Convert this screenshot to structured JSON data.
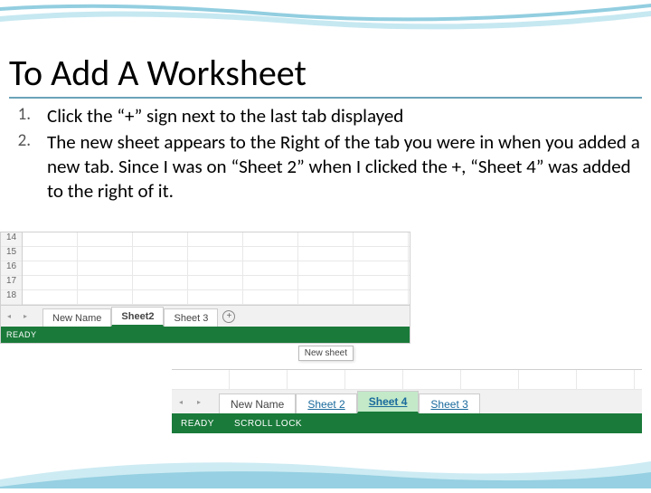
{
  "slide": {
    "title": "To Add A Worksheet",
    "steps": [
      {
        "num": "1.",
        "text": "Click the “+” sign next to the last tab displayed"
      },
      {
        "num": "2.",
        "text": "The new sheet appears to the Right of the tab you were in when you added a new tab. Since I was on “Sheet 2” when I clicked the +, “Sheet 4” was added to the right of it."
      }
    ]
  },
  "shot1": {
    "rows": [
      "14",
      "15",
      "16",
      "17",
      "18"
    ],
    "tabs": {
      "t1": "New Name",
      "t2": "Sheet2",
      "t3": "Sheet 3"
    },
    "add_symbol": "+",
    "status": "READY",
    "tooltip": "New sheet",
    "nav_left": "◂",
    "nav_right": "▸"
  },
  "shot2": {
    "tabs": {
      "t1": "New Name",
      "t2": "Sheet 2",
      "t3": "Sheet 4",
      "t4": "Sheet 3"
    },
    "status_ready": "READY",
    "status_scroll": "SCROLL LOCK",
    "nav_left": "◂",
    "nav_right": "▸"
  }
}
